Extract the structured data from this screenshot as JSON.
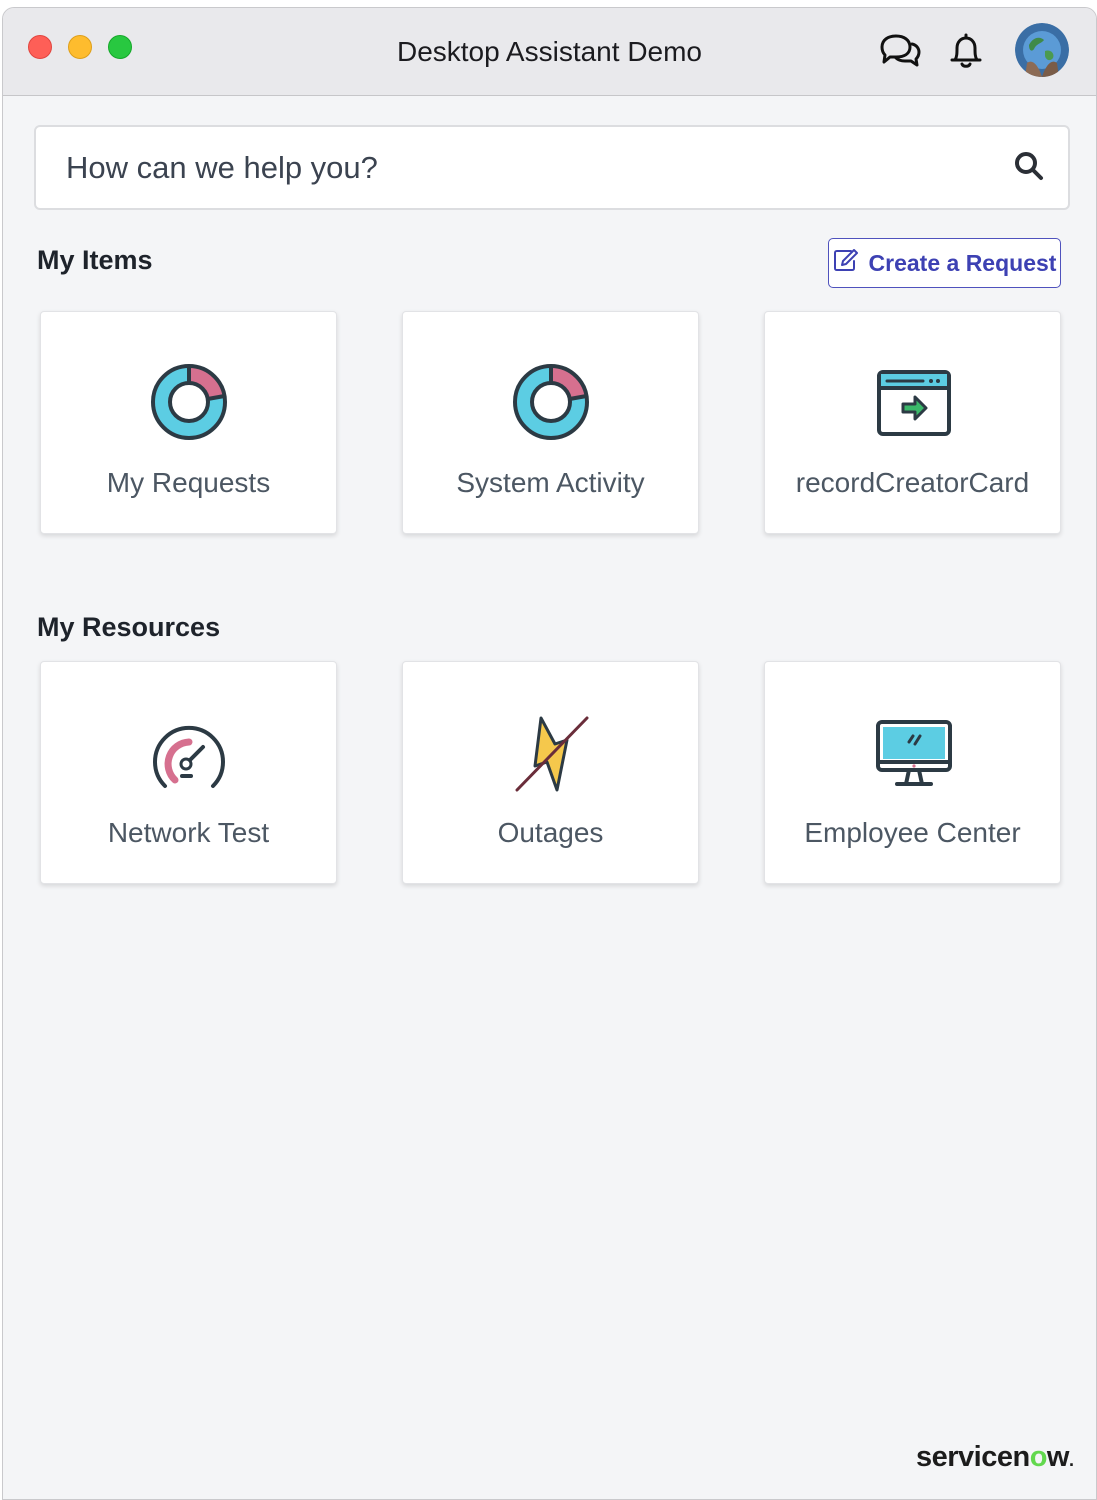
{
  "window": {
    "title": "Desktop Assistant Demo",
    "controls": [
      "close",
      "minimize",
      "maximize"
    ],
    "header_icons": [
      "chat-icon",
      "bell-icon",
      "user-avatar"
    ]
  },
  "search": {
    "placeholder": "How can we help you?",
    "icon": "search-icon"
  },
  "my_items": {
    "heading": "My Items",
    "create_button": "Create a Request",
    "cards": [
      {
        "label": "My Requests",
        "icon": "donut-chart-icon"
      },
      {
        "label": "System Activity",
        "icon": "donut-chart-icon"
      },
      {
        "label": "recordCreatorCard",
        "icon": "record-creator-icon"
      }
    ]
  },
  "my_resources": {
    "heading": "My Resources",
    "cards": [
      {
        "label": "Network Test",
        "icon": "speedometer-icon"
      },
      {
        "label": "Outages",
        "icon": "lightning-off-icon"
      },
      {
        "label": "Employee Center",
        "icon": "monitor-icon"
      }
    ]
  },
  "footer": {
    "brand_prefix": "servicen",
    "brand_o": "o",
    "brand_suffix": "w",
    "brand_dot": "."
  },
  "colors": {
    "accent": "#3d41b3",
    "teal": "#5ccde3",
    "pink": "#d6708f",
    "yellow": "#f5c84c",
    "green": "#3bb86a",
    "servicenow_green": "#62d84e"
  }
}
